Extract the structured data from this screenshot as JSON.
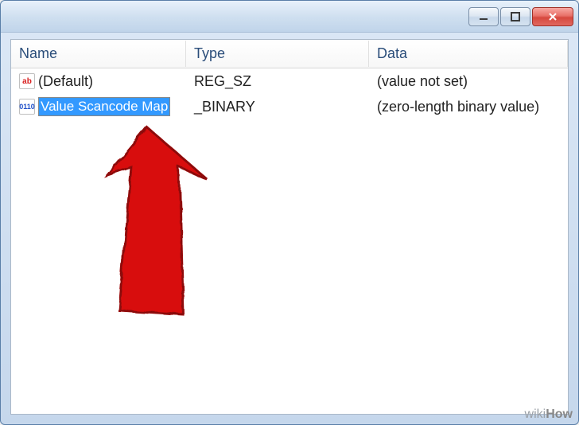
{
  "columns": {
    "name": "Name",
    "type": "Type",
    "data": "Data"
  },
  "rows": [
    {
      "icon": "sz",
      "name": "(Default)",
      "type": "REG_SZ",
      "data": "(value not set)",
      "editing": false
    },
    {
      "icon": "binary",
      "name": "Value Scancode Map",
      "type": "_BINARY",
      "data": "(zero-length binary value)",
      "editing": true
    }
  ],
  "icon_labels": {
    "sz": "ab",
    "binary": "0110"
  },
  "watermark": {
    "wiki": "wiki",
    "how": "How"
  }
}
